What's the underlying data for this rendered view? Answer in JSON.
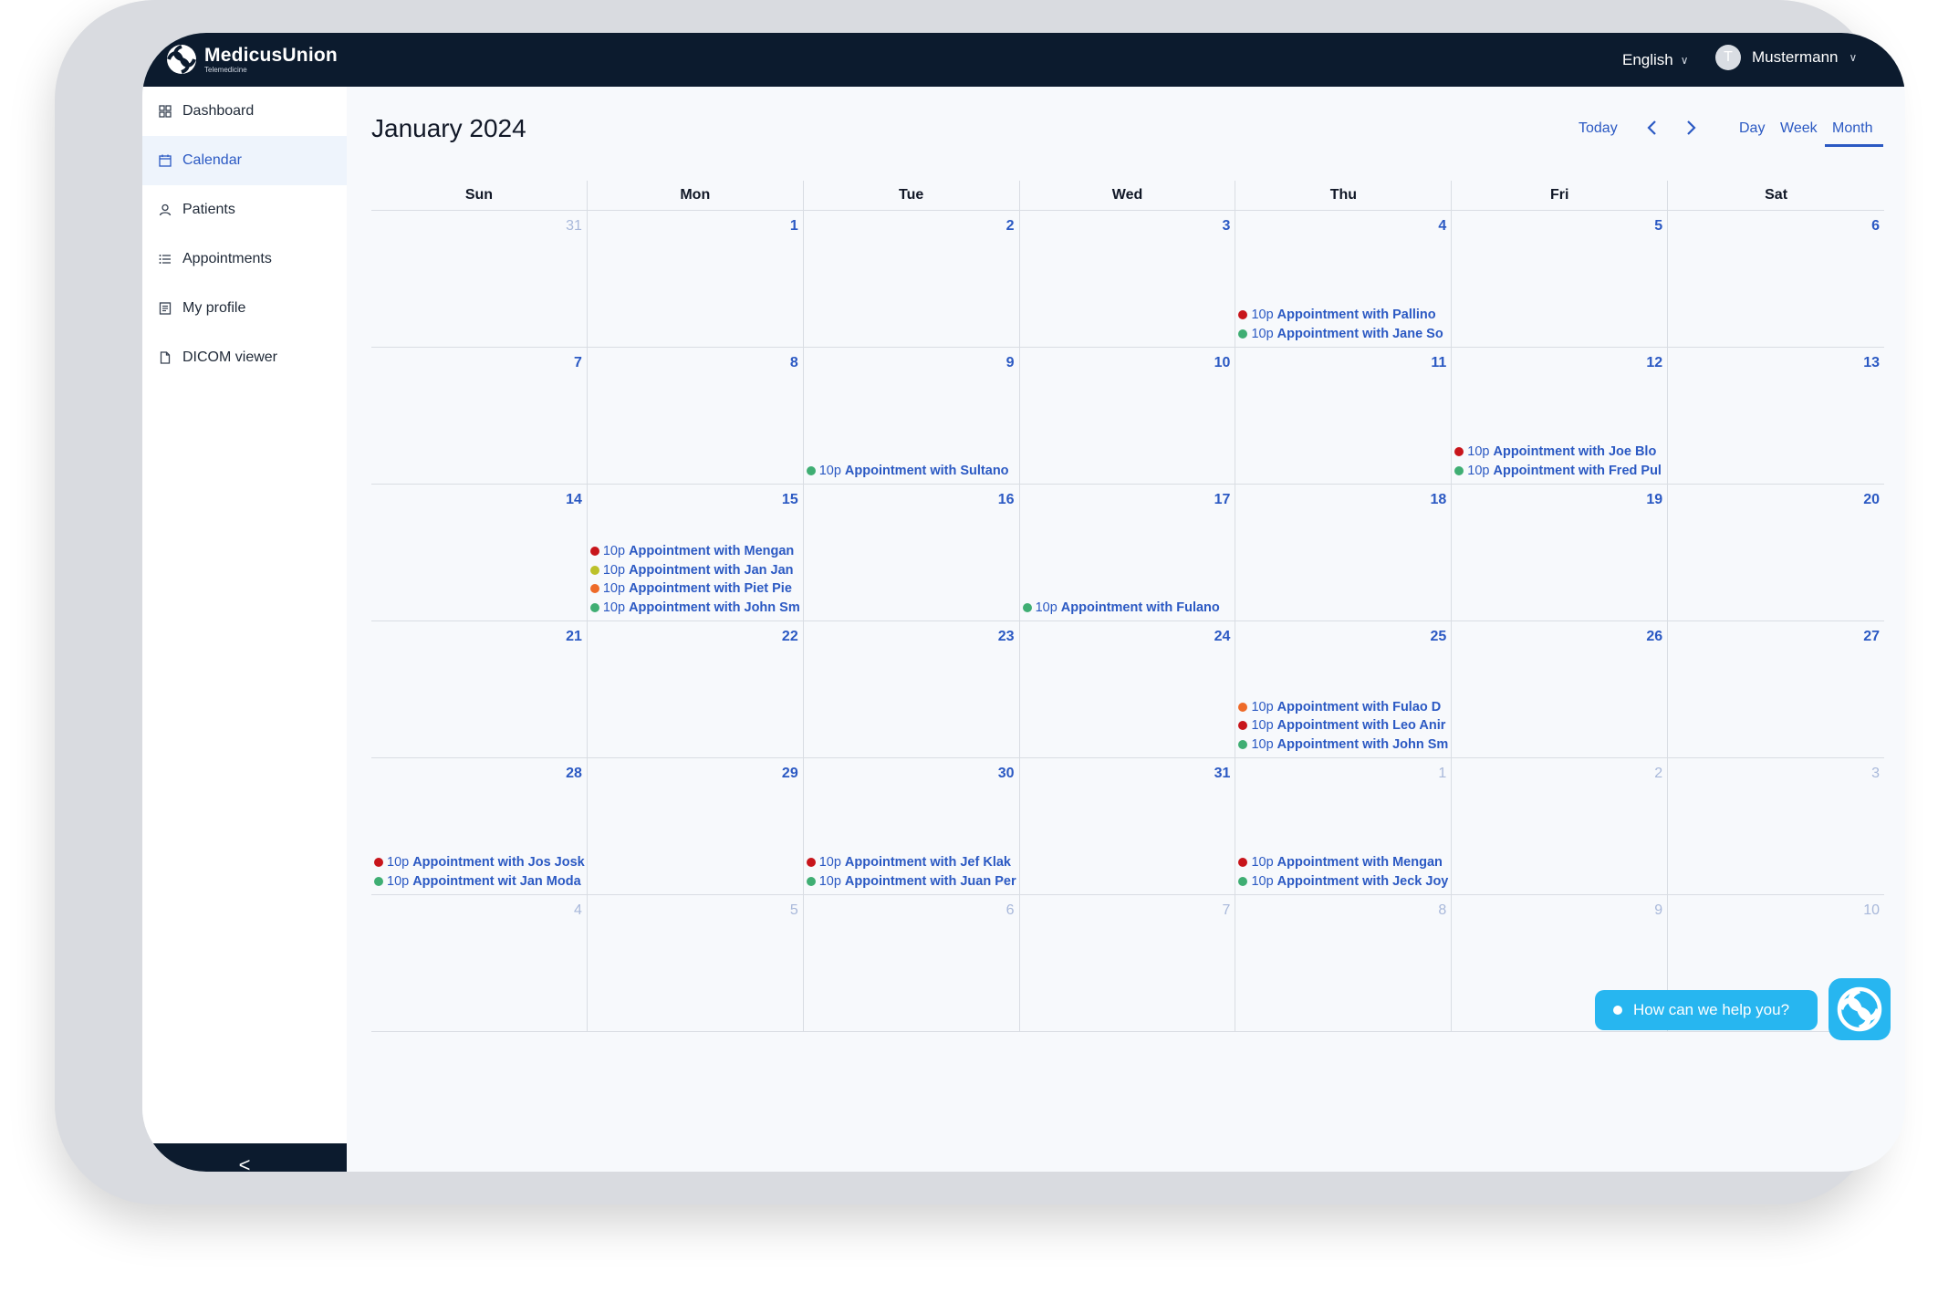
{
  "app": {
    "brand": "MedicusUnion",
    "tagline": "Telemedicine"
  },
  "header": {
    "language": "English",
    "user_initial": "T",
    "user_name": "Mustermann"
  },
  "sidebar": {
    "items": [
      {
        "label": "Dashboard",
        "icon": "grid-icon"
      },
      {
        "label": "Calendar",
        "icon": "calendar-icon",
        "active": true
      },
      {
        "label": "Patients",
        "icon": "person-icon"
      },
      {
        "label": "Appointments",
        "icon": "list-icon"
      },
      {
        "label": "My profile",
        "icon": "profile-card-icon"
      },
      {
        "label": "DICOM viewer",
        "icon": "file-icon"
      }
    ],
    "collapse_label": "<"
  },
  "toolbar": {
    "title": "January 2024",
    "today_label": "Today",
    "prev_label": "‹",
    "next_label": "›",
    "views": [
      "Day",
      "Week",
      "Month"
    ],
    "active_view": "Month"
  },
  "colors": {
    "red": "#c8151b",
    "green": "#3fae73",
    "yellow": "#bcc12a",
    "orange": "#ee6a28",
    "accent": "#2b59c3"
  },
  "weekdays": [
    "Sun",
    "Mon",
    "Tue",
    "Wed",
    "Thu",
    "Fri",
    "Sat"
  ],
  "weeks": [
    [
      {
        "d": "31",
        "m": true,
        "ev": []
      },
      {
        "d": "1",
        "ev": []
      },
      {
        "d": "2",
        "ev": []
      },
      {
        "d": "3",
        "ev": []
      },
      {
        "d": "4",
        "ev": [
          {
            "c": "red",
            "t": "10p",
            "title": "Appointment with Pallino"
          },
          {
            "c": "green",
            "t": "10p",
            "title": "Appointment with Jane So"
          }
        ]
      },
      {
        "d": "5",
        "ev": []
      },
      {
        "d": "6",
        "ev": []
      }
    ],
    [
      {
        "d": "7",
        "ev": []
      },
      {
        "d": "8",
        "ev": []
      },
      {
        "d": "9",
        "ev": [
          {
            "c": "green",
            "t": "10p",
            "title": "Appointment with Sultano"
          }
        ]
      },
      {
        "d": "10",
        "ev": []
      },
      {
        "d": "11",
        "ev": []
      },
      {
        "d": "12",
        "ev": [
          {
            "c": "red",
            "t": "10p",
            "title": "Appointment with Joe Blo"
          },
          {
            "c": "green",
            "t": "10p",
            "title": "Appointment with Fred Pul"
          }
        ]
      },
      {
        "d": "13",
        "ev": []
      }
    ],
    [
      {
        "d": "14",
        "ev": []
      },
      {
        "d": "15",
        "ev": [
          {
            "c": "red",
            "t": "10p",
            "title": "Appointment with Mengan"
          },
          {
            "c": "yellow",
            "t": "10p",
            "title": "Appointment with Jan Jan"
          },
          {
            "c": "orange",
            "t": "10p",
            "title": "Appointment with Piet Pie"
          },
          {
            "c": "green",
            "t": "10p",
            "title": "Appointment with John Sm"
          }
        ]
      },
      {
        "d": "16",
        "ev": []
      },
      {
        "d": "17",
        "ev": [
          {
            "c": "green",
            "t": "10p",
            "title": "Appointment with Fulano"
          }
        ]
      },
      {
        "d": "18",
        "ev": []
      },
      {
        "d": "19",
        "ev": []
      },
      {
        "d": "20",
        "ev": []
      }
    ],
    [
      {
        "d": "21",
        "ev": []
      },
      {
        "d": "22",
        "ev": []
      },
      {
        "d": "23",
        "ev": []
      },
      {
        "d": "24",
        "ev": []
      },
      {
        "d": "25",
        "ev": [
          {
            "c": "orange",
            "t": "10p",
            "title": "Appointment with Fulao D"
          },
          {
            "c": "red",
            "t": "10p",
            "title": "Appointment with Leo Anir"
          },
          {
            "c": "green",
            "t": "10p",
            "title": "Appointment with John Sm"
          }
        ]
      },
      {
        "d": "26",
        "ev": []
      },
      {
        "d": "27",
        "ev": []
      }
    ],
    [
      {
        "d": "28",
        "ev": [
          {
            "c": "red",
            "t": "10p",
            "title": "Appointment with Jos Josk"
          },
          {
            "c": "green",
            "t": "10p",
            "title": "Appointment wit Jan Moda"
          }
        ]
      },
      {
        "d": "29",
        "ev": []
      },
      {
        "d": "30",
        "ev": [
          {
            "c": "red",
            "t": "10p",
            "title": "Appointment with Jef Klak"
          },
          {
            "c": "green",
            "t": "10p",
            "title": "Appointment with Juan Per"
          }
        ]
      },
      {
        "d": "31",
        "ev": []
      },
      {
        "d": "1",
        "m": true,
        "ev": [
          {
            "c": "red",
            "t": "10p",
            "title": "Appointment with Mengan"
          },
          {
            "c": "green",
            "t": "10p",
            "title": "Appointment with Jeck Joy"
          }
        ]
      },
      {
        "d": "2",
        "m": true,
        "ev": []
      },
      {
        "d": "3",
        "m": true,
        "ev": []
      }
    ],
    [
      {
        "d": "4",
        "m": true,
        "ev": []
      },
      {
        "d": "5",
        "m": true,
        "ev": []
      },
      {
        "d": "6",
        "m": true,
        "ev": []
      },
      {
        "d": "7",
        "m": true,
        "ev": []
      },
      {
        "d": "8",
        "m": true,
        "ev": []
      },
      {
        "d": "9",
        "m": true,
        "ev": []
      },
      {
        "d": "10",
        "m": true,
        "ev": []
      }
    ]
  ],
  "chat": {
    "label": "How can we help you?"
  }
}
